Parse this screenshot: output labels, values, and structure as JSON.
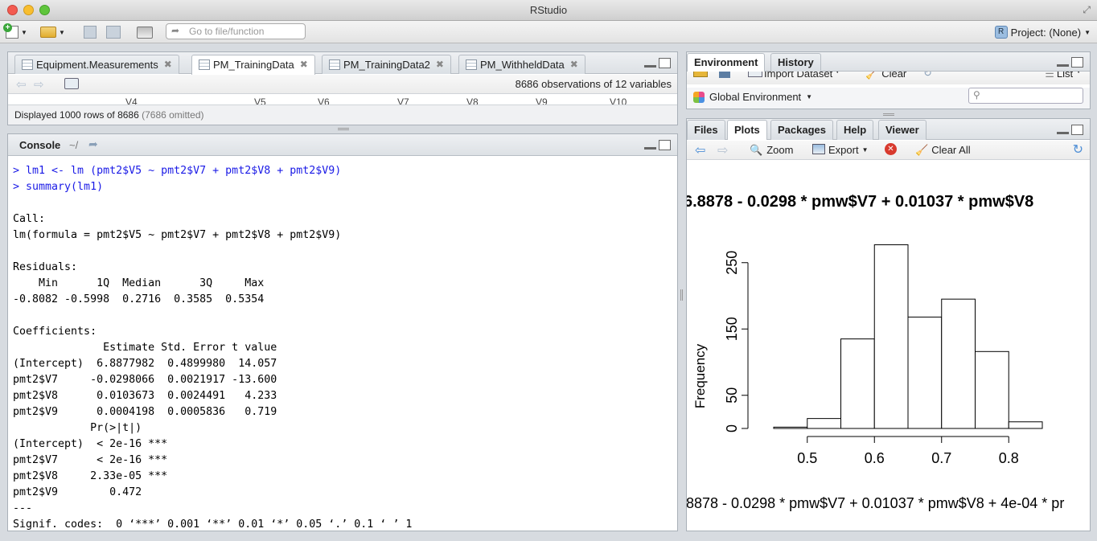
{
  "window": {
    "title": "RStudio"
  },
  "toolbar": {
    "goto_placeholder": "Go to file/function",
    "project_label": "Project: (None)"
  },
  "source_pane": {
    "tabs": [
      {
        "label": "Equipment.Measurements"
      },
      {
        "label": "PM_TrainingData"
      },
      {
        "label": "PM_TrainingData2"
      },
      {
        "label": "PM_WithheldData"
      }
    ],
    "obs_info": "8686 observations of 12 variables",
    "col_headers": [
      "V4",
      "V5",
      "V6",
      "V7",
      "V8",
      "V9",
      "V10"
    ],
    "displayed_text": "Displayed 1000 rows of 8686",
    "omitted_text": "(7686 omitted)"
  },
  "console": {
    "title": "Console",
    "path": "~/",
    "commands": [
      "> lm1 <- lm (pmt2$V5 ~ pmt2$V7 + pmt2$V8 + pmt2$V9)",
      "> summary(lm1)"
    ],
    "output": "\nCall:\nlm(formula = pmt2$V5 ~ pmt2$V7 + pmt2$V8 + pmt2$V9)\n\nResiduals:\n    Min      1Q  Median      3Q     Max \n-0.8082 -0.5998  0.2716  0.3585  0.5354 \n\nCoefficients:\n              Estimate Std. Error t value\n(Intercept)  6.8877982  0.4899980  14.057\npmt2$V7     -0.0298066  0.0021917 -13.600\npmt2$V8      0.0103673  0.0024491   4.233\npmt2$V9      0.0004198  0.0005836   0.719\n            Pr(>|t|)    \n(Intercept)  < 2e-16 ***\npmt2$V7      < 2e-16 ***\npmt2$V8     2.33e-05 ***\npmt2$V9        0.472    \n---\nSignif. codes:  0 ‘***’ 0.001 ‘**’ 0.01 ‘*’ 0.05 ‘.’ 0.1 ‘ ’ 1"
  },
  "env_pane": {
    "tabs": [
      {
        "label": "Environment"
      },
      {
        "label": "History"
      }
    ],
    "import_label": "Import Dataset",
    "clear_label": "Clear",
    "list_label": "List",
    "global_env_label": "Global Environment"
  },
  "plots_pane": {
    "tabs": [
      {
        "label": "Files"
      },
      {
        "label": "Plots"
      },
      {
        "label": "Packages"
      },
      {
        "label": "Help"
      },
      {
        "label": "Viewer"
      }
    ],
    "zoom_label": "Zoom",
    "export_label": "Export",
    "clear_all_label": "Clear All"
  },
  "chart_data": {
    "type": "bar",
    "title": "6.8878 - 0.0298 * pmw$V7 + 0.01037 * pmw$V8",
    "xlabel": ".8878 - 0.0298 * pmw$V7 + 0.01037 * pmw$V8 + 4e-04 * pr",
    "ylabel": "Frequency",
    "bin_edges": [
      0.45,
      0.5,
      0.55,
      0.6,
      0.65,
      0.7,
      0.75,
      0.8,
      0.85
    ],
    "values": [
      2,
      15,
      135,
      277,
      168,
      195,
      116,
      10
    ],
    "xticks": [
      0.5,
      0.6,
      0.7,
      0.8
    ],
    "xtick_labels": [
      "0.5",
      "0.6",
      "0.7",
      "0.8"
    ],
    "yticks": [
      0,
      50,
      150,
      250
    ],
    "ytick_labels": [
      "0",
      "50",
      "150",
      "250"
    ],
    "ylim": [
      0,
      280
    ],
    "xlim": [
      0.45,
      0.85
    ],
    "grid": false
  }
}
